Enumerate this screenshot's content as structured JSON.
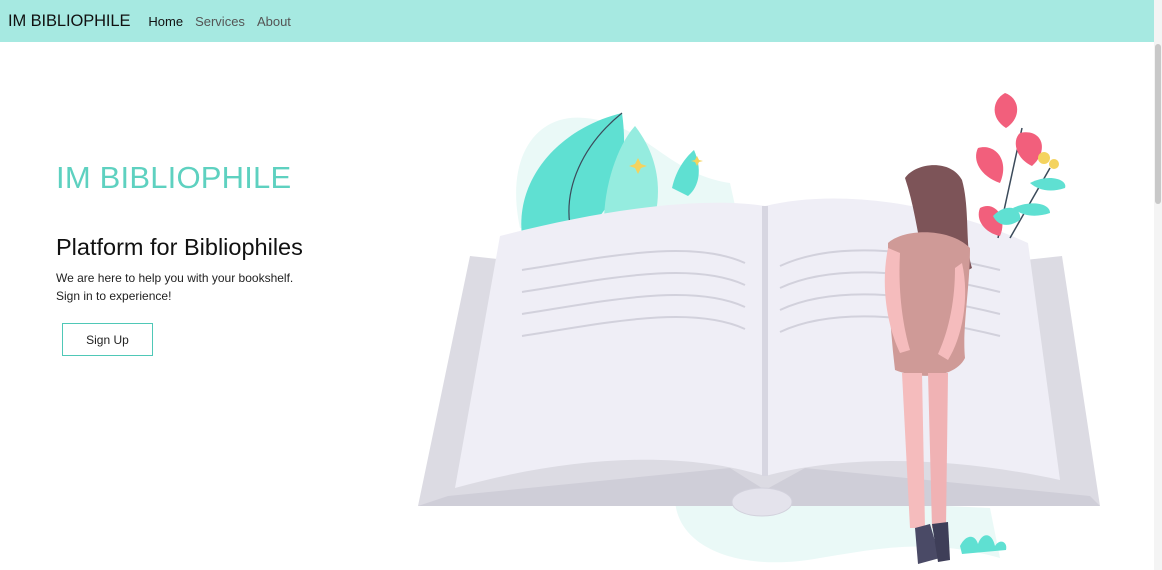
{
  "navbar": {
    "brand": "IM BIBLIOPHILE",
    "links": [
      {
        "label": "Home"
      },
      {
        "label": "Services"
      },
      {
        "label": "About"
      }
    ],
    "background": "#a6e9e1"
  },
  "hero": {
    "title": "IM BIBLIOPHILE",
    "subtitle": "Platform for Bibliophiles",
    "text_line1": "We are here to help you with your bookshelf.",
    "text_line2": "Sign in to experience!",
    "signup_label": "Sign Up",
    "accent_color": "#5ed1c0"
  },
  "illustration": {
    "icon": "reading-woman-book-illustration"
  }
}
